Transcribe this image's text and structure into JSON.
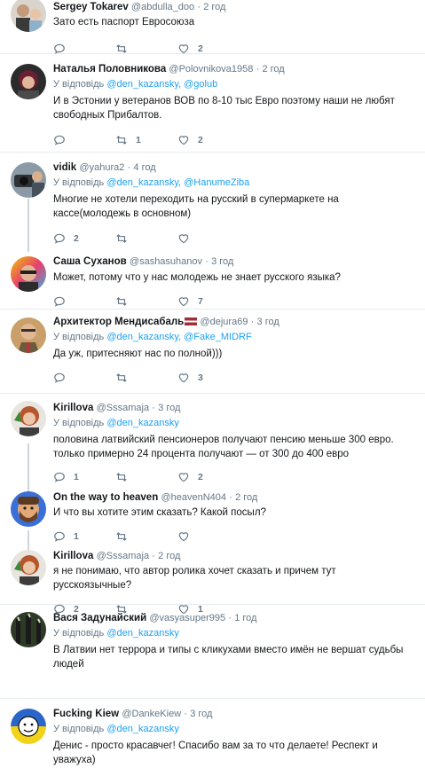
{
  "tweets": [
    {
      "name": "Sergey Tokarev",
      "handle": "@abdulla_doo",
      "time": "2 год",
      "reply_prefix": "",
      "mentions": "",
      "text": "Зато есть паспорт Евросоюза",
      "counts": {
        "reply": "",
        "retweet": "",
        "like": "2"
      }
    },
    {
      "name": "Наталья Половникова",
      "handle": "@Polovnikova1958",
      "time": "2 год",
      "reply_prefix": "У відповідь",
      "mentions": "@den_kazansky, @golub",
      "text": "И в Эстонии у ветеранов ВОВ по 8-10 тыс Евро поэтому наши не любят свободных Прибалтов.",
      "counts": {
        "reply": "",
        "retweet": "1",
        "like": "2"
      }
    },
    {
      "name": "vidik",
      "handle": "@yahura2",
      "time": "4 год",
      "reply_prefix": "У відповідь",
      "mentions": "@den_kazansky, @HanumeZiba",
      "text": "Многие не хотели переходить на русский в супермаркете на кассе(молодежь в основном)",
      "counts": {
        "reply": "2",
        "retweet": "",
        "like": ""
      }
    },
    {
      "name": "Саша Суханов",
      "handle": "@sashasuhanov",
      "time": "3 год",
      "reply_prefix": "",
      "mentions": "",
      "text": "Может, потому что у нас молодежь не знает русского языка?",
      "counts": {
        "reply": "",
        "retweet": "",
        "like": "7"
      }
    },
    {
      "name": "Архитектор Мендисабаль",
      "handle": "@dejura69",
      "time": "3 год",
      "reply_prefix": "У відповідь",
      "mentions": "@den_kazansky, @Fake_MIDRF",
      "text": "Да уж, притесняют нас по полной)))",
      "counts": {
        "reply": "",
        "retweet": "",
        "like": "3"
      }
    },
    {
      "name": "Kirillova",
      "handle": "@Sssamaja",
      "time": "3 год",
      "reply_prefix": "У відповідь",
      "mentions": "@den_kazansky",
      "text": "половина латвийский пенсионеров получают пенсию меньше 300 евро. только примерно 24 процента получают — от 300 до 400 евро",
      "counts": {
        "reply": "1",
        "retweet": "",
        "like": "2"
      }
    },
    {
      "name": "On the way to heaven",
      "handle": "@heavenN404",
      "time": "2 год",
      "reply_prefix": "",
      "mentions": "",
      "text": "И что вы хотите этим сказать? Какой посыл?",
      "counts": {
        "reply": "1",
        "retweet": "",
        "like": ""
      }
    },
    {
      "name": "Kirillova",
      "handle": "@Sssamaja",
      "time": "2 год",
      "reply_prefix": "",
      "mentions": "",
      "text": "я не понимаю, что автор ролика хочет сказать и причем тут русскоязычные?",
      "counts": {
        "reply": "2",
        "retweet": "",
        "like": "1"
      }
    },
    {
      "name": "Вася Задунайский",
      "handle": "@vasyasuper995",
      "time": "1 год",
      "reply_prefix": "У відповідь",
      "mentions": "@den_kazansky",
      "text": "В Латвии нет террора и типы с кликухами вместо имён не вершат судьбы людей",
      "counts": {
        "reply": "",
        "retweet": "",
        "like": ""
      }
    },
    {
      "name": "Fucking Kiew",
      "handle": "@DankeKiew",
      "time": "3 год",
      "reply_prefix": "У відповідь",
      "mentions": "@den_kazansky",
      "text": "Денис - просто красавчег! Спасибо вам за то что делаете! Респект и уважуха)",
      "counts": {
        "reply": "",
        "retweet": "",
        "like": ""
      }
    }
  ],
  "dot": "·",
  "colors": {
    "link": "#1da1f2",
    "muted": "#657786",
    "border": "#e6ecf0"
  }
}
